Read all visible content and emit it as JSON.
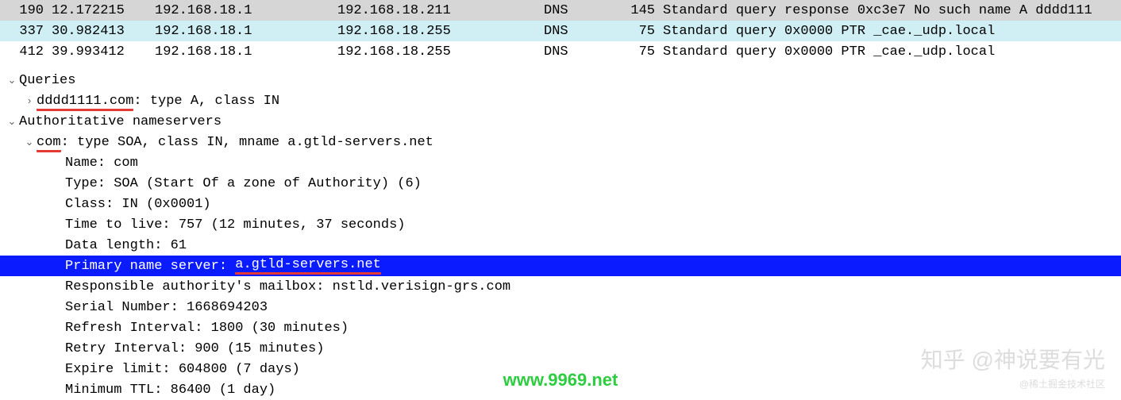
{
  "packets": [
    {
      "no": "190",
      "time": "12.172215",
      "src": "192.168.18.1",
      "dst": "192.168.18.211",
      "proto": "DNS",
      "len": "145",
      "info": "Standard query response 0xc3e7 No such name A dddd111",
      "bg": "row-gray"
    },
    {
      "no": "337",
      "time": "30.982413",
      "src": "192.168.18.1",
      "dst": "192.168.18.255",
      "proto": "DNS",
      "len": "75",
      "info": "Standard query 0x0000 PTR _cae._udp.local",
      "bg": "row-cyan"
    },
    {
      "no": "412",
      "time": "39.993412",
      "src": "192.168.18.1",
      "dst": "192.168.18.255",
      "proto": "DNS",
      "len": "75",
      "info": "Standard query 0x0000 PTR _cae._udp.local",
      "bg": "row-white"
    }
  ],
  "detail": {
    "queries_header": "Queries",
    "query_line_prefix": "dddd1111.com",
    "query_line_suffix": ": type A, class IN",
    "auth_header": "Authoritative nameservers",
    "soa_line_prefix": "com",
    "soa_line_suffix": ": type SOA, class IN, mname a.gtld-servers.net",
    "fields": {
      "name": "Name: com",
      "type": "Type: SOA (Start Of a zone of Authority) (6)",
      "class": "Class: IN (0x0001)",
      "ttl": "Time to live: 757 (12 minutes, 37 seconds)",
      "datalen": "Data length: 61",
      "pns_label": "Primary name server: ",
      "pns_value": "a.gtld-servers.net",
      "mailbox": "Responsible authority's mailbox: nstld.verisign-grs.com",
      "serial": "Serial Number: 1668694203",
      "refresh": "Refresh Interval: 1800 (30 minutes)",
      "retry": "Retry Interval: 900 (15 minutes)",
      "expire": "Expire limit: 604800 (7 days)",
      "minttl": "Minimum TTL: 86400 (1 day)"
    }
  },
  "watermarks": {
    "center": "www.9969.net",
    "right": "知乎 @神说要有光",
    "right_small": "@稀土掘金技术社区"
  },
  "icons": {
    "expanded": "⌄",
    "collapsed": "›"
  }
}
